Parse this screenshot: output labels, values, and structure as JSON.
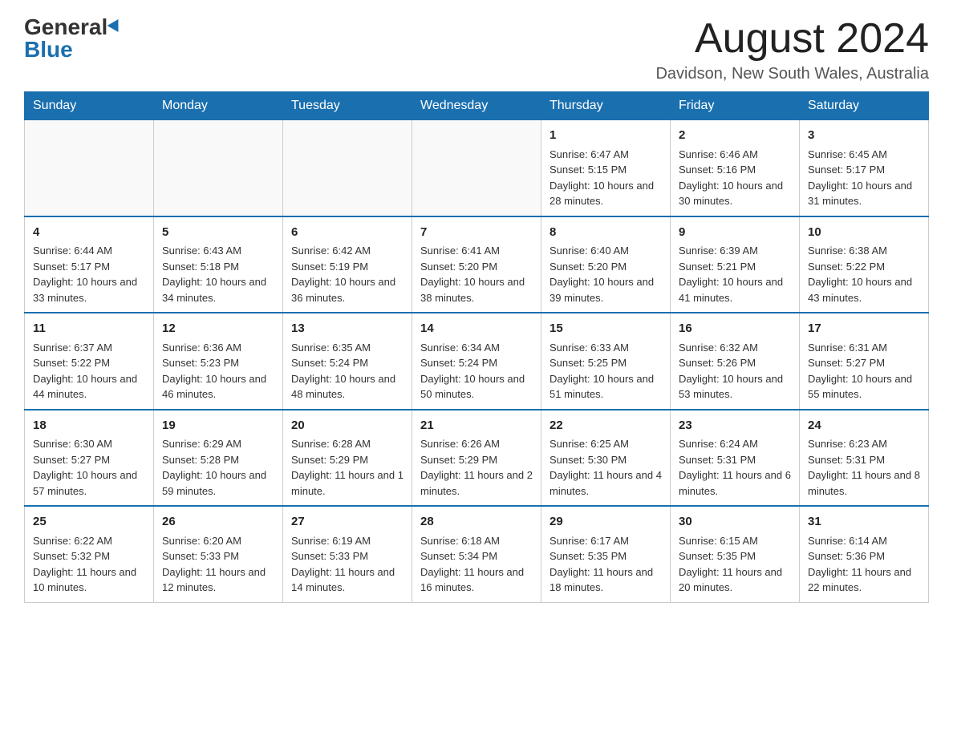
{
  "header": {
    "logo_general": "General",
    "logo_blue": "Blue",
    "month_title": "August 2024",
    "location": "Davidson, New South Wales, Australia"
  },
  "days_of_week": [
    "Sunday",
    "Monday",
    "Tuesday",
    "Wednesday",
    "Thursday",
    "Friday",
    "Saturday"
  ],
  "weeks": [
    [
      {
        "day": "",
        "info": ""
      },
      {
        "day": "",
        "info": ""
      },
      {
        "day": "",
        "info": ""
      },
      {
        "day": "",
        "info": ""
      },
      {
        "day": "1",
        "info": "Sunrise: 6:47 AM\nSunset: 5:15 PM\nDaylight: 10 hours and 28 minutes."
      },
      {
        "day": "2",
        "info": "Sunrise: 6:46 AM\nSunset: 5:16 PM\nDaylight: 10 hours and 30 minutes."
      },
      {
        "day": "3",
        "info": "Sunrise: 6:45 AM\nSunset: 5:17 PM\nDaylight: 10 hours and 31 minutes."
      }
    ],
    [
      {
        "day": "4",
        "info": "Sunrise: 6:44 AM\nSunset: 5:17 PM\nDaylight: 10 hours and 33 minutes."
      },
      {
        "day": "5",
        "info": "Sunrise: 6:43 AM\nSunset: 5:18 PM\nDaylight: 10 hours and 34 minutes."
      },
      {
        "day": "6",
        "info": "Sunrise: 6:42 AM\nSunset: 5:19 PM\nDaylight: 10 hours and 36 minutes."
      },
      {
        "day": "7",
        "info": "Sunrise: 6:41 AM\nSunset: 5:20 PM\nDaylight: 10 hours and 38 minutes."
      },
      {
        "day": "8",
        "info": "Sunrise: 6:40 AM\nSunset: 5:20 PM\nDaylight: 10 hours and 39 minutes."
      },
      {
        "day": "9",
        "info": "Sunrise: 6:39 AM\nSunset: 5:21 PM\nDaylight: 10 hours and 41 minutes."
      },
      {
        "day": "10",
        "info": "Sunrise: 6:38 AM\nSunset: 5:22 PM\nDaylight: 10 hours and 43 minutes."
      }
    ],
    [
      {
        "day": "11",
        "info": "Sunrise: 6:37 AM\nSunset: 5:22 PM\nDaylight: 10 hours and 44 minutes."
      },
      {
        "day": "12",
        "info": "Sunrise: 6:36 AM\nSunset: 5:23 PM\nDaylight: 10 hours and 46 minutes."
      },
      {
        "day": "13",
        "info": "Sunrise: 6:35 AM\nSunset: 5:24 PM\nDaylight: 10 hours and 48 minutes."
      },
      {
        "day": "14",
        "info": "Sunrise: 6:34 AM\nSunset: 5:24 PM\nDaylight: 10 hours and 50 minutes."
      },
      {
        "day": "15",
        "info": "Sunrise: 6:33 AM\nSunset: 5:25 PM\nDaylight: 10 hours and 51 minutes."
      },
      {
        "day": "16",
        "info": "Sunrise: 6:32 AM\nSunset: 5:26 PM\nDaylight: 10 hours and 53 minutes."
      },
      {
        "day": "17",
        "info": "Sunrise: 6:31 AM\nSunset: 5:27 PM\nDaylight: 10 hours and 55 minutes."
      }
    ],
    [
      {
        "day": "18",
        "info": "Sunrise: 6:30 AM\nSunset: 5:27 PM\nDaylight: 10 hours and 57 minutes."
      },
      {
        "day": "19",
        "info": "Sunrise: 6:29 AM\nSunset: 5:28 PM\nDaylight: 10 hours and 59 minutes."
      },
      {
        "day": "20",
        "info": "Sunrise: 6:28 AM\nSunset: 5:29 PM\nDaylight: 11 hours and 1 minute."
      },
      {
        "day": "21",
        "info": "Sunrise: 6:26 AM\nSunset: 5:29 PM\nDaylight: 11 hours and 2 minutes."
      },
      {
        "day": "22",
        "info": "Sunrise: 6:25 AM\nSunset: 5:30 PM\nDaylight: 11 hours and 4 minutes."
      },
      {
        "day": "23",
        "info": "Sunrise: 6:24 AM\nSunset: 5:31 PM\nDaylight: 11 hours and 6 minutes."
      },
      {
        "day": "24",
        "info": "Sunrise: 6:23 AM\nSunset: 5:31 PM\nDaylight: 11 hours and 8 minutes."
      }
    ],
    [
      {
        "day": "25",
        "info": "Sunrise: 6:22 AM\nSunset: 5:32 PM\nDaylight: 11 hours and 10 minutes."
      },
      {
        "day": "26",
        "info": "Sunrise: 6:20 AM\nSunset: 5:33 PM\nDaylight: 11 hours and 12 minutes."
      },
      {
        "day": "27",
        "info": "Sunrise: 6:19 AM\nSunset: 5:33 PM\nDaylight: 11 hours and 14 minutes."
      },
      {
        "day": "28",
        "info": "Sunrise: 6:18 AM\nSunset: 5:34 PM\nDaylight: 11 hours and 16 minutes."
      },
      {
        "day": "29",
        "info": "Sunrise: 6:17 AM\nSunset: 5:35 PM\nDaylight: 11 hours and 18 minutes."
      },
      {
        "day": "30",
        "info": "Sunrise: 6:15 AM\nSunset: 5:35 PM\nDaylight: 11 hours and 20 minutes."
      },
      {
        "day": "31",
        "info": "Sunrise: 6:14 AM\nSunset: 5:36 PM\nDaylight: 11 hours and 22 minutes."
      }
    ]
  ]
}
